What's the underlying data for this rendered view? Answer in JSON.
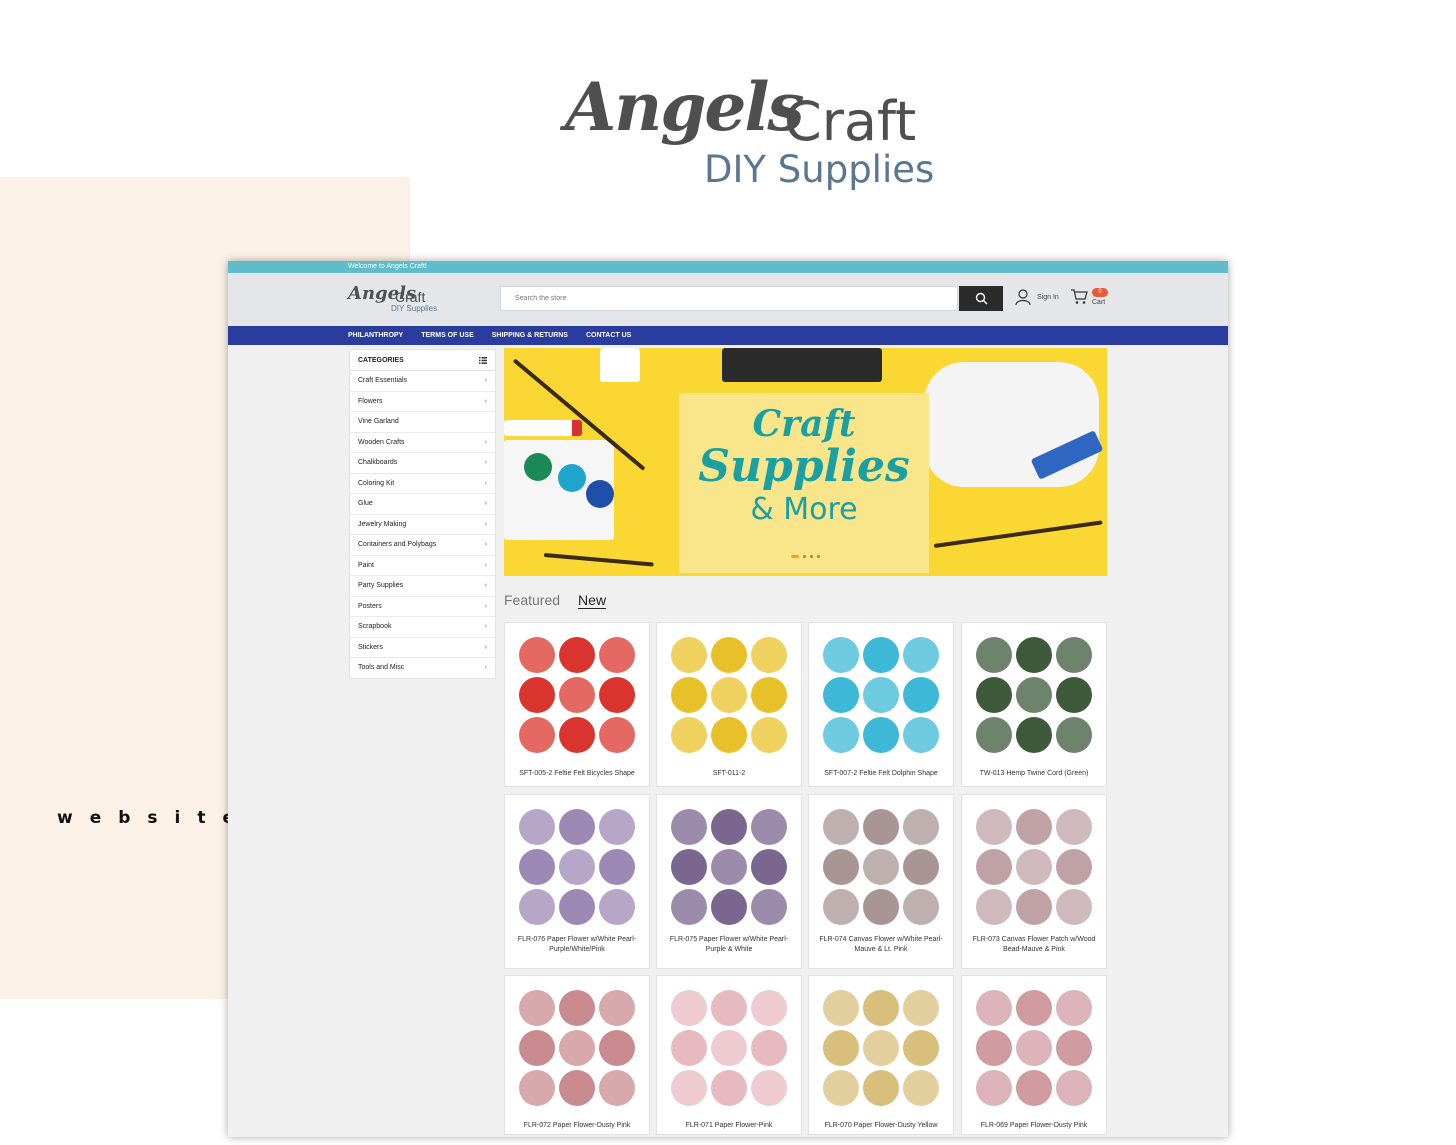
{
  "brand": {
    "logo_script": "Angels",
    "logo_word": "Craft",
    "logo_sub": "DIY Supplies"
  },
  "tagline": "website design",
  "site": {
    "announcement": "Welcome to Angels Craft!",
    "search_placeholder": "Search the store",
    "signin_label": "Sign In",
    "cart_count": "0",
    "cart_label": "Cart",
    "nav": [
      "PHILANTHROPY",
      "TERMS OF USE",
      "SHIPPING & RETURNS",
      "CONTACT US"
    ],
    "categories_title": "CATEGORIES",
    "categories": [
      {
        "label": "Craft Essentials",
        "has_sub": true
      },
      {
        "label": "Flowers",
        "has_sub": true
      },
      {
        "label": "Vine Garland",
        "has_sub": false
      },
      {
        "label": "Wooden Crafts",
        "has_sub": true
      },
      {
        "label": "Chalkboards",
        "has_sub": true
      },
      {
        "label": "Coloring Kit",
        "has_sub": true
      },
      {
        "label": "Glue",
        "has_sub": true
      },
      {
        "label": "Jewelry Making",
        "has_sub": true
      },
      {
        "label": "Containers and Polybags",
        "has_sub": true
      },
      {
        "label": "Paint",
        "has_sub": true
      },
      {
        "label": "Party Supplies",
        "has_sub": true
      },
      {
        "label": "Posters",
        "has_sub": true
      },
      {
        "label": "Scrapbook",
        "has_sub": true
      },
      {
        "label": "Stickers",
        "has_sub": true
      },
      {
        "label": "Tools and Misc",
        "has_sub": true
      }
    ],
    "banner": {
      "line1": "Craft",
      "line2": "Supplies",
      "line3": "& More"
    },
    "tabs": {
      "featured": "Featured",
      "new": "New"
    },
    "products": [
      {
        "name": "SFT-005-2 Feltie Felt Bicycles Shape",
        "color": "#d9352e"
      },
      {
        "name": "SFT-011-2",
        "color": "#e8c12a"
      },
      {
        "name": "SFT-007-2 Feltie Felt Dolphin Shape",
        "color": "#3db8d6"
      },
      {
        "name": "TW-013 Hemp Twine Cord (Green)",
        "color": "#3d5a3a"
      },
      {
        "name": "FLR-076 Paper Flower w/White Pearl-Purple/White/Pink",
        "color": "#9d89b5"
      },
      {
        "name": "FLR-075 Paper Flower w/White Pearl-Purple & White",
        "color": "#7b6690"
      },
      {
        "name": "FLR-074 Canvas Flower w/White Pearl-Mauve & Lt. Pink",
        "color": "#a89594"
      },
      {
        "name": "FLR-073 Canvas Flower Patch w/Wood Bead-Mauve & Pink",
        "color": "#bfa1a6"
      },
      {
        "name": "FLR-072 Paper Flower-Dusty Pink",
        "color": "#c98b90"
      },
      {
        "name": "FLR-071 Paper Flower-Pink",
        "color": "#e7b9c0"
      },
      {
        "name": "FLR-070 Paper Flower-Dusty Yellow",
        "color": "#d9bf7c"
      },
      {
        "name": "FLR-069 Paper Flower-Dusty Pink",
        "color": "#cf9aa0"
      }
    ]
  }
}
